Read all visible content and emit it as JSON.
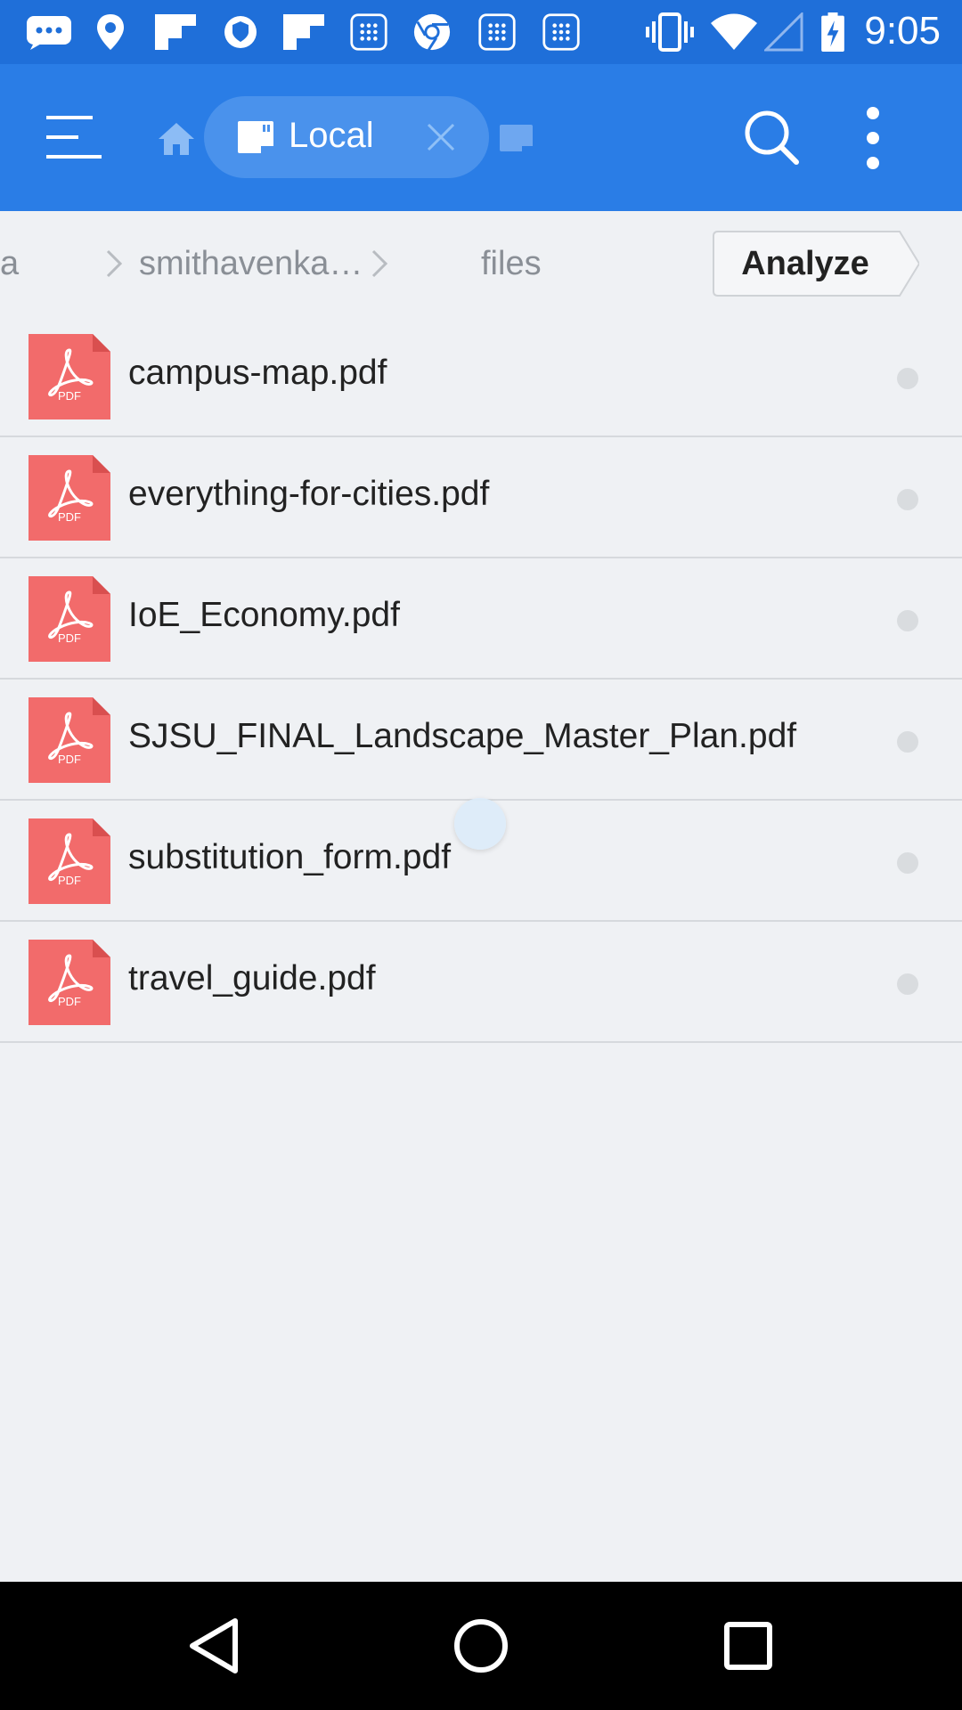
{
  "status_bar": {
    "time": "9:05",
    "icons": [
      "messages-icon",
      "location-icon",
      "flipboard-icon",
      "shield-icon",
      "flipboard-icon",
      "calculator-icon",
      "chrome-icon",
      "calculator-icon",
      "calculator-icon",
      "vibrate-icon",
      "wifi-icon",
      "signal-icon",
      "battery-charging-icon"
    ]
  },
  "app_bar": {
    "active_tab_label": "Local",
    "icons": [
      "menu-icon",
      "home-icon",
      "storage-icon",
      "close-icon",
      "storage-icon",
      "search-icon",
      "more-vert-icon"
    ]
  },
  "breadcrumb": {
    "items": [
      "a",
      "smithavenka…",
      "files"
    ],
    "analyze_label": "Analyze"
  },
  "files": [
    {
      "name": "campus-map.pdf",
      "icon_label": "PDF"
    },
    {
      "name": "everything-for-cities.pdf",
      "icon_label": "PDF"
    },
    {
      "name": "IoE_Economy.pdf",
      "icon_label": "PDF"
    },
    {
      "name": "SJSU_FINAL_Landscape_Master_Plan.pdf",
      "icon_label": "PDF"
    },
    {
      "name": "substitution_form.pdf",
      "icon_label": "PDF"
    },
    {
      "name": "travel_guide.pdf",
      "icon_label": "PDF"
    }
  ],
  "nav_bar": {
    "icons": [
      "back-icon",
      "home-circle-icon",
      "recents-icon"
    ]
  },
  "colors": {
    "status_bar": "#1f6fd9",
    "app_bar": "#2a7de6",
    "tab_pill": "#4a92ec",
    "background": "#eff1f4",
    "pdf_icon": "#f26b6b"
  }
}
